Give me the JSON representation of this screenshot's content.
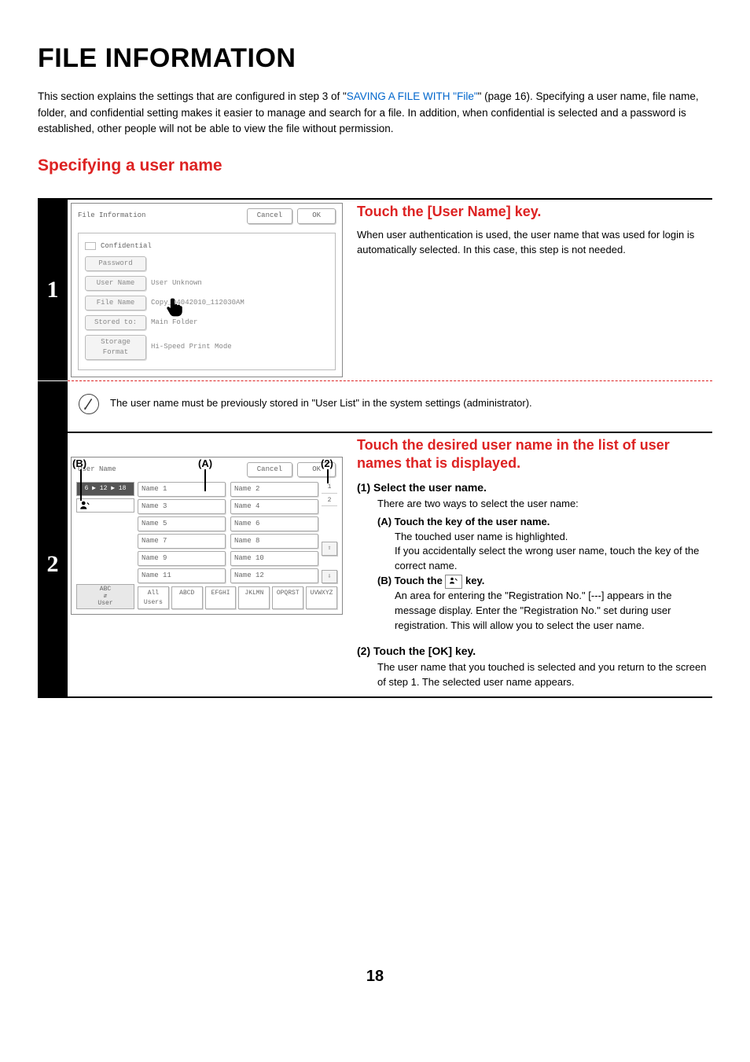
{
  "title": "FILE INFORMATION",
  "intro_pre": "This section explains the settings that are configured in step 3 of \"",
  "intro_link": "SAVING A FILE WITH \"File\"",
  "intro_post": "\" (page 16). Specifying a user name, file name, folder, and confidential setting makes it easier to manage and search for a file. In addition, when confidential is selected and a password is established, other people will not be able to view the file without permission.",
  "section_heading": "Specifying a user name",
  "page_number": "18",
  "step1": {
    "num": "1",
    "panel": {
      "title": "File Information",
      "cancel": "Cancel",
      "ok": "OK",
      "rows": {
        "confidential": "Confidential",
        "password_label": "Password",
        "username_label": "User Name",
        "username_val": "User Unknown",
        "filename_label": "File Name",
        "filename_val": "Copy_04042010_112030AM",
        "stored_label": "Stored to:",
        "stored_val": "Main Folder",
        "storage_label": "Storage Format",
        "storage_val": "Hi-Speed Print Mode"
      }
    },
    "heading": "Touch the [User Name] key.",
    "body": "When user authentication is used, the user name that was used for login is automatically selected. In this case, this step is not needed.",
    "note": "The user name must be previously stored in \"User List\" in the system settings (administrator)."
  },
  "step2": {
    "num": "2",
    "labels": {
      "B": "(B)",
      "A": "(A)",
      "two": "(2)"
    },
    "panel": {
      "title": "User Name",
      "cancel": "Cancel",
      "ok": "OK",
      "index_tab": "6 ▶ 12 ▶ 18",
      "abc": "ABC",
      "user": "User",
      "names": [
        "Name 1",
        "Name 2",
        "Name 3",
        "Name 4",
        "Name 5",
        "Name 6",
        "Name 7",
        "Name 8",
        "Name 9",
        "Name 10",
        "Name 11",
        "Name 12"
      ],
      "pages": [
        "1",
        "2"
      ],
      "up": "⇧",
      "down": "⇩",
      "filters": [
        "All Users",
        "ABCD",
        "EFGHI",
        "JKLMN",
        "OPQRST",
        "UVWXYZ"
      ]
    },
    "heading": "Touch the desired user name in the list of user names that is displayed.",
    "item1_h": "(1)  Select the user name.",
    "item1_t": "There are two ways to select the user name:",
    "itemA_h": "(A) Touch the key of the user name.",
    "itemA_t": "The touched user name is highlighted.\nIf you accidentally select the wrong user name, touch the key of the correct name.",
    "itemB_h_pre": "(B) Touch the ",
    "itemB_h_post": " key.",
    "itemB_t": "An area for entering the \"Registration No.\" [---] appears in the message display. Enter the \"Registration No.\" set during user registration. This will allow you to select the user name.",
    "item2_h": "(2)  Touch the [OK] key.",
    "item2_t": "The user name that you touched is selected and you return to the screen of step 1. The selected user name appears."
  }
}
